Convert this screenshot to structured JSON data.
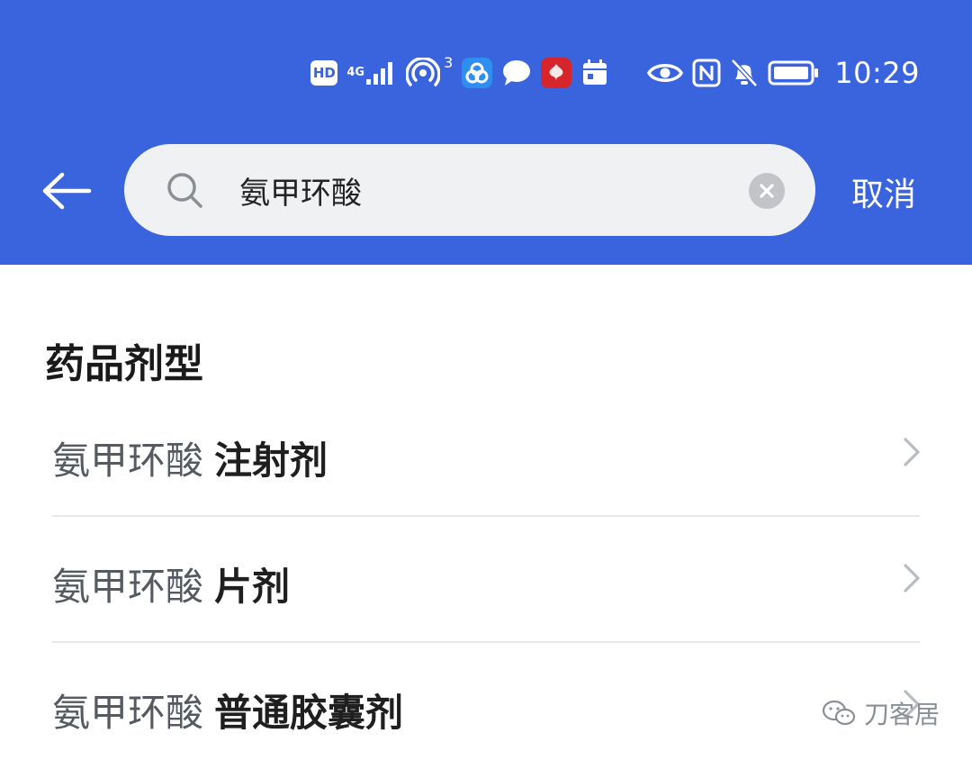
{
  "status_bar": {
    "hd": "HD",
    "network": "4G",
    "hotspot_count": "3",
    "time": "10:29",
    "icons": [
      "hd-badge",
      "signal-icon",
      "hotspot-icon",
      "app-icon",
      "chat-icon",
      "red-app-icon",
      "calendar-icon",
      "eye-icon",
      "nfc-icon",
      "mute-bell-icon",
      "battery-icon"
    ]
  },
  "search": {
    "query": "氨甲环酸",
    "cancel_label": "取消"
  },
  "section": {
    "title": "药品剂型"
  },
  "results": [
    {
      "name": "氨甲环酸",
      "form": "注射剂"
    },
    {
      "name": "氨甲环酸",
      "form": "片剂"
    },
    {
      "name": "氨甲环酸",
      "form": "普通胶囊剂"
    }
  ],
  "watermark": {
    "text": "刀客居"
  },
  "colors": {
    "header_bg": "#3a63de",
    "search_bg": "#eff1f3",
    "divider": "#e6e8eb"
  }
}
